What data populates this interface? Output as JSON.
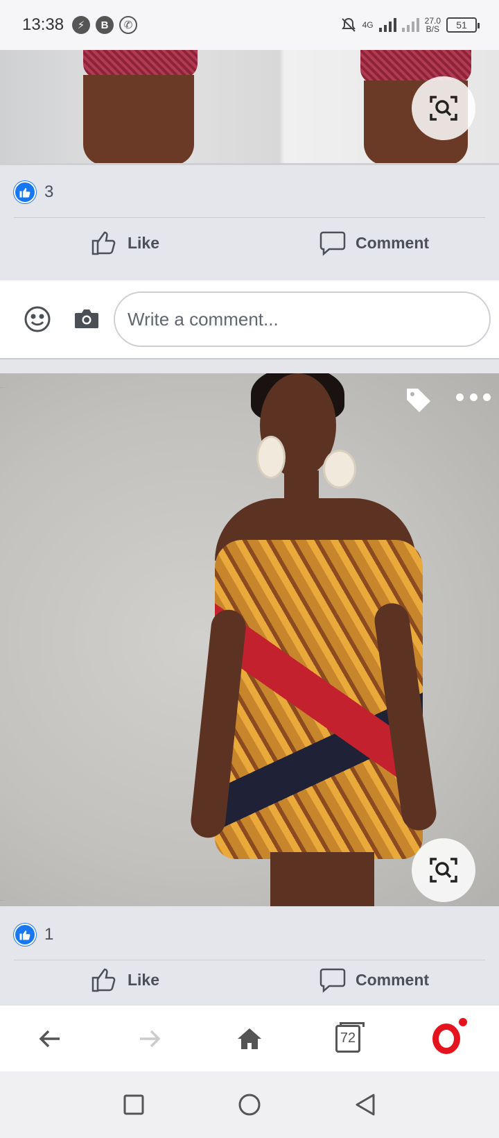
{
  "status_bar": {
    "time": "13:38",
    "left_icons": [
      "lightning-icon",
      "b-badge-icon",
      "whatsapp-icon"
    ],
    "network_type": "4G",
    "speed_value": "27.0",
    "speed_unit": "B/S",
    "battery": "51"
  },
  "posts": [
    {
      "reaction_count": "3",
      "like_label": "Like",
      "comment_label": "Comment"
    },
    {
      "reaction_count": "1",
      "like_label": "Like",
      "comment_label": "Comment"
    }
  ],
  "comment_box": {
    "placeholder": "Write a comment..."
  },
  "browser": {
    "tab_count": "72"
  },
  "colors": {
    "facebook_blue": "#1877f2",
    "opera_red": "#e5131d",
    "text_gray": "#4b4f56"
  }
}
